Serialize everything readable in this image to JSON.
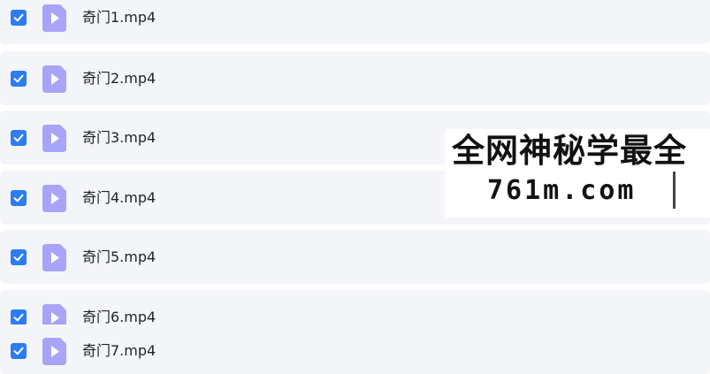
{
  "files": [
    {
      "name": "奇门1.mp4",
      "checked": true
    },
    {
      "name": "奇门2.mp4",
      "checked": true
    },
    {
      "name": "奇门3.mp4",
      "checked": true
    },
    {
      "name": "奇门4.mp4",
      "checked": true
    },
    {
      "name": "奇门5.mp4",
      "checked": true
    },
    {
      "name": "奇门6.mp4",
      "checked": true
    },
    {
      "name": "奇门7.mp4",
      "checked": true
    }
  ],
  "watermark": {
    "line1": "全网神秘学最全",
    "line2": "761m.com"
  },
  "colors": {
    "checkbox": "#2b7cf6",
    "file_icon": "#a8a4f8",
    "row_background": "#f4f5f9"
  },
  "icons": {
    "checkbox": "checkmark-icon",
    "file": "video-file-icon"
  }
}
